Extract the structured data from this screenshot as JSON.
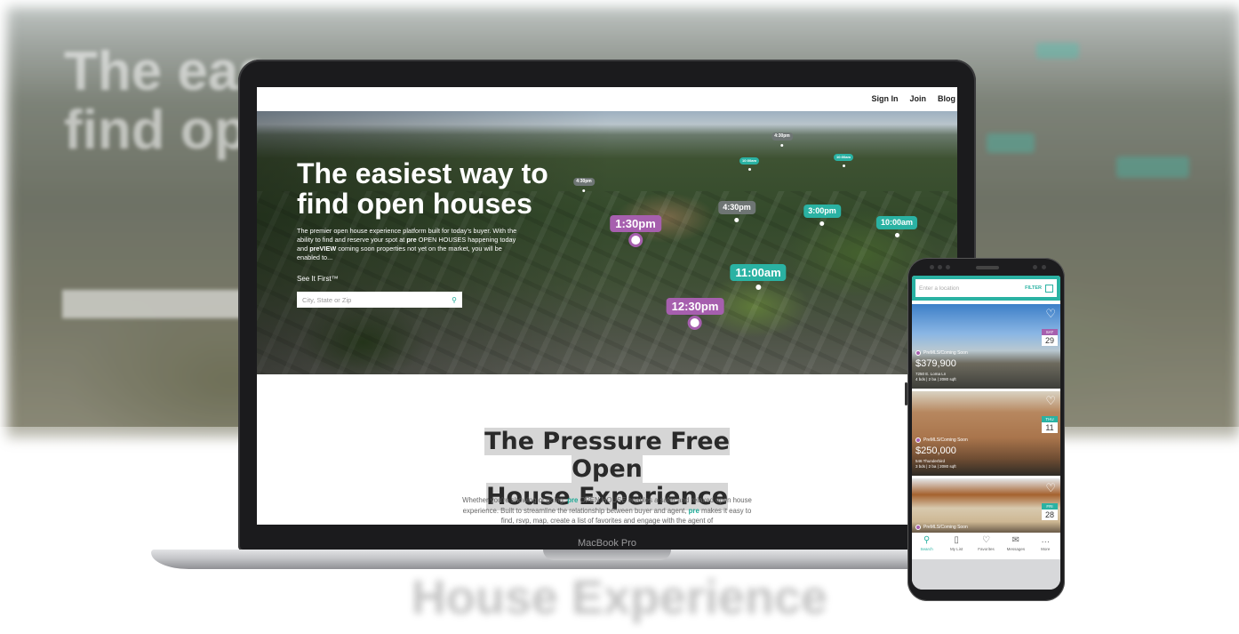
{
  "backdrop": {
    "ghost_title": "The eas\nfind op",
    "ghost_bottom": "House Experience"
  },
  "laptop": {
    "brand": "MacBook Pro",
    "nav": [
      "Sign In",
      "Join",
      "Blog"
    ],
    "hero": {
      "title": "The easiest way to find open houses",
      "description_1": "The premier open house experience platform built for today's buyer. With the ability to find and reserve your spot at ",
      "description_pre": "pre",
      "description_2": " OPEN HOUSES happening today and ",
      "description_preview": "preVIEW",
      "description_3": " coming soon properties not yet on the market, you will be enabled to...",
      "see_it_first": "See It First™",
      "search_placeholder": "City, State or Zip",
      "search_icon": "search-icon"
    },
    "pins": [
      {
        "time": "1:30pm",
        "color": "purple"
      },
      {
        "time": "12:30pm",
        "color": "purple"
      },
      {
        "time": "11:00am",
        "color": "teal"
      },
      {
        "time": "4:30pm",
        "color": "gray"
      },
      {
        "time": "3:00pm",
        "color": "teal"
      },
      {
        "time": "10:00am",
        "color": "teal"
      },
      {
        "time": "4:30pm",
        "color": "gray"
      },
      {
        "time": "4:30pm",
        "color": "gray"
      },
      {
        "time": "10:00am",
        "color": "teal"
      },
      {
        "time": "10:00am",
        "color": "teal"
      }
    ],
    "section": {
      "title_line1": "The Pressure Free Open",
      "title_line2": "House Experience",
      "body_1": "Whether you're showing or going, ",
      "body_pre1": "pre",
      "body_2": " OPEN HOUSE enables a safer and relaxed open house experience. Built to streamline the relationship between buyer and agent, ",
      "body_pre2": "pre",
      "body_3": " makes it easy to find, rsvp, map, create a list of favorites and engage with the agent of"
    }
  },
  "phone": {
    "search_placeholder": "Enter a location",
    "filter_label": "FILTER",
    "map_icon": "map-icon",
    "listings": [
      {
        "day": "SAT",
        "date": "29",
        "tag": "PreMLS/Coming Soon",
        "price": "$379,900",
        "address": "7250 E. Loma Ln",
        "details": "4 bds | 2 ba | 2080 sqft",
        "day_color": "#a65fae"
      },
      {
        "day": "THU",
        "date": "11",
        "tag": "PreMLS/Coming Soon",
        "price": "$250,000",
        "address": "546 Thunderbird",
        "details": "3 bds | 2 ba | 2080 sqft",
        "day_color": "#2ab2a3"
      },
      {
        "day": "FRI",
        "date": "28",
        "tag": "PreMLS/Coming Soon",
        "price": "",
        "address": "",
        "details": "",
        "day_color": "#2ab2a3"
      }
    ],
    "tabs": [
      {
        "label": "Search",
        "icon": "search-icon",
        "active": true
      },
      {
        "label": "My List",
        "icon": "list-icon",
        "active": false
      },
      {
        "label": "Favorites",
        "icon": "heart-icon",
        "active": false
      },
      {
        "label": "Messages",
        "icon": "mail-icon",
        "active": false
      },
      {
        "label": "More",
        "icon": "more-icon",
        "active": false
      }
    ]
  },
  "colors": {
    "teal": "#2ab2a3",
    "purple": "#a65fae",
    "gray_pin": "#6e7574"
  }
}
